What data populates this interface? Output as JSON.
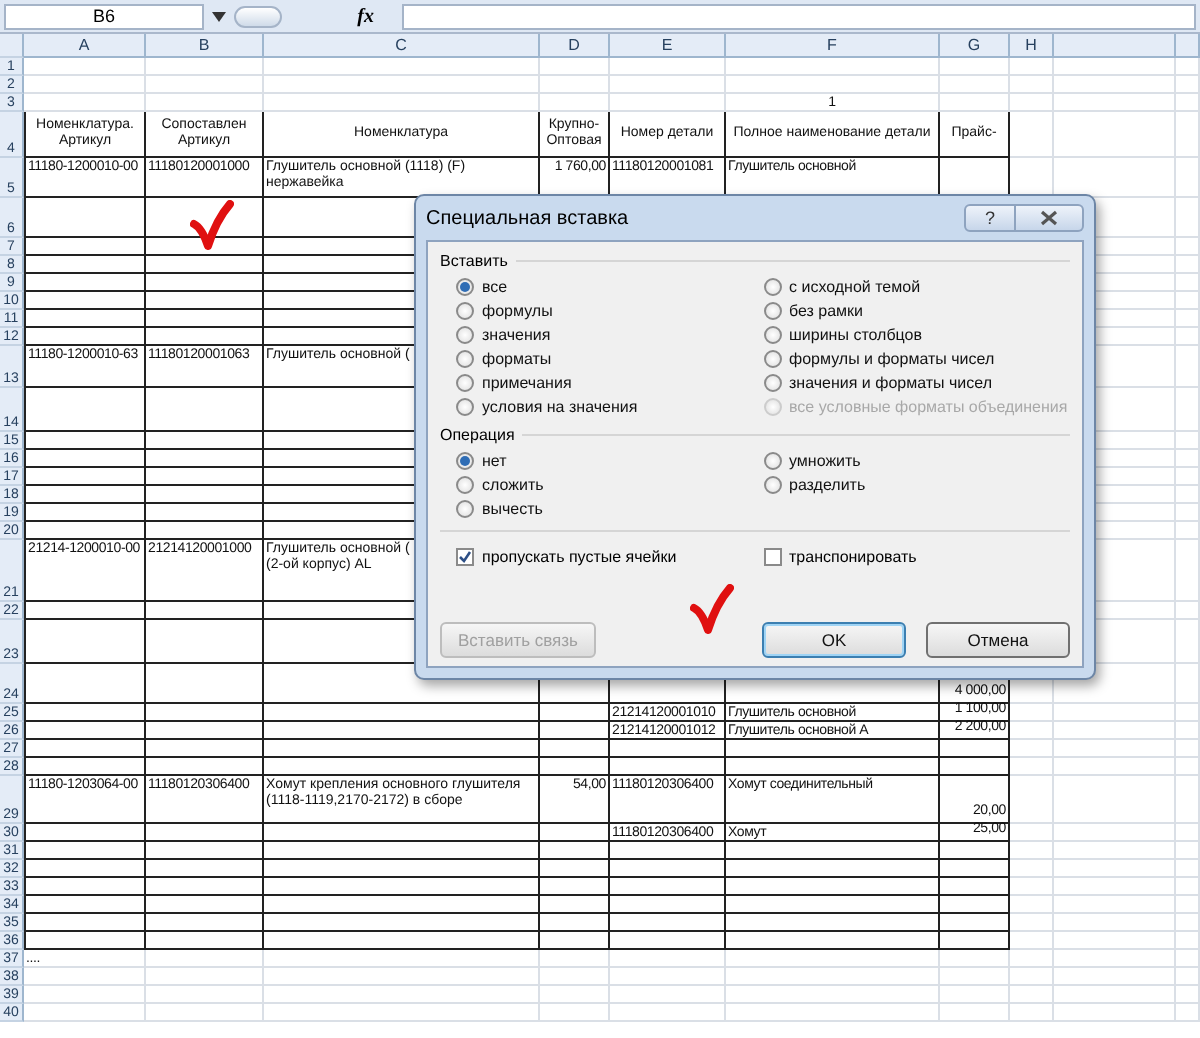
{
  "formula_bar": {
    "name_box": "B6",
    "function_label": "fx"
  },
  "sheet": {
    "columns": [
      "A",
      "B",
      "C",
      "D",
      "E",
      "F",
      "G",
      "H"
    ],
    "rows": [
      {
        "number": "1",
        "cells": {}
      },
      {
        "number": "2",
        "cells": {}
      },
      {
        "number": "3",
        "cells": {
          "f": "1"
        }
      },
      {
        "number": "4",
        "cells": {
          "a": "Номенклатура. Артикул",
          "b": "Сопоставлен Артикул",
          "c": "Номенклатура",
          "d": "Крупно-Оптовая",
          "e": "Номер детали",
          "f": "Полное наименование детали",
          "g": "Прайс-"
        }
      },
      {
        "number": "5",
        "cells": {
          "a": "11180-1200010-00",
          "b": "11180120001000",
          "c": "Глушитель основной (1118) (F) нержавейка",
          "d": "1 760,00",
          "e": "11180120001081",
          "f": "Глушитель основной"
        }
      },
      {
        "number": "6",
        "cells": {}
      },
      {
        "number": "7",
        "cells": {}
      },
      {
        "number": "8",
        "cells": {}
      },
      {
        "number": "9",
        "cells": {}
      },
      {
        "number": "10",
        "cells": {}
      },
      {
        "number": "11",
        "cells": {}
      },
      {
        "number": "12",
        "cells": {}
      },
      {
        "number": "13",
        "cells": {
          "a": "11180-1200010-63",
          "b": "11180120001063",
          "c": "Глушитель основной ("
        }
      },
      {
        "number": "14",
        "cells": {}
      },
      {
        "number": "15",
        "cells": {}
      },
      {
        "number": "16",
        "cells": {}
      },
      {
        "number": "17",
        "cells": {}
      },
      {
        "number": "18",
        "cells": {}
      },
      {
        "number": "19",
        "cells": {}
      },
      {
        "number": "20",
        "cells": {}
      },
      {
        "number": "21",
        "cells": {
          "a": "21214-1200010-00",
          "b": "21214120001000",
          "c": "Глушитель основной (\n(2-ой корпус) AL"
        }
      },
      {
        "number": "22",
        "cells": {}
      },
      {
        "number": "23",
        "cells": {}
      },
      {
        "number": "24",
        "cells": {
          "g": "4 000,00"
        }
      },
      {
        "number": "25",
        "cells": {
          "e": "21214120001010",
          "f": "Глушитель основной",
          "g": "1 100,00"
        }
      },
      {
        "number": "26",
        "cells": {
          "e": "21214120001012",
          "f": "Глушитель основной А",
          "g": "2 200,00"
        }
      },
      {
        "number": "27",
        "cells": {}
      },
      {
        "number": "28",
        "cells": {}
      },
      {
        "number": "29",
        "cells": {
          "a": "11180-1203064-00",
          "b": "11180120306400",
          "c": "Хомут крепления основного глушителя (1118-1119,2170-2172) в сборе",
          "d": "54,00",
          "e": "11180120306400",
          "f": "Хомут соединительный",
          "g": "20,00"
        }
      },
      {
        "number": "30",
        "cells": {
          "e": "11180120306400",
          "f": "Хомут",
          "g": "25,00"
        }
      },
      {
        "number": "31",
        "cells": {}
      },
      {
        "number": "32",
        "cells": {}
      },
      {
        "number": "33",
        "cells": {}
      },
      {
        "number": "34",
        "cells": {}
      },
      {
        "number": "35",
        "cells": {}
      },
      {
        "number": "36",
        "cells": {}
      },
      {
        "number": "37",
        "cells": {
          "a": "...."
        }
      },
      {
        "number": "38",
        "cells": {}
      },
      {
        "number": "39",
        "cells": {}
      },
      {
        "number": "40",
        "cells": {}
      }
    ]
  },
  "dialog": {
    "title": "Специальная вставка",
    "help": "?",
    "paste_group": {
      "label": "Вставить",
      "options": [
        {
          "label": "все",
          "selected": true,
          "disabled": false
        },
        {
          "label": "формулы",
          "selected": false,
          "disabled": false
        },
        {
          "label": "значения",
          "selected": false,
          "disabled": false
        },
        {
          "label": "форматы",
          "selected": false,
          "disabled": false
        },
        {
          "label": "примечания",
          "selected": false,
          "disabled": false
        },
        {
          "label": "условия на значения",
          "selected": false,
          "disabled": false
        },
        {
          "label": "с исходной темой",
          "selected": false,
          "disabled": false
        },
        {
          "label": "без рамки",
          "selected": false,
          "disabled": false
        },
        {
          "label": "ширины столбцов",
          "selected": false,
          "disabled": false
        },
        {
          "label": "формулы и форматы чисел",
          "selected": false,
          "disabled": false
        },
        {
          "label": "значения и форматы чисел",
          "selected": false,
          "disabled": false
        },
        {
          "label": "все условные форматы объединения",
          "selected": false,
          "disabled": true
        }
      ]
    },
    "operation_group": {
      "label": "Операция",
      "options": [
        {
          "label": "нет",
          "selected": true,
          "disabled": false
        },
        {
          "label": "сложить",
          "selected": false,
          "disabled": false
        },
        {
          "label": "вычесть",
          "selected": false,
          "disabled": false
        },
        {
          "label": "умножить",
          "selected": false,
          "disabled": false
        },
        {
          "label": "разделить",
          "selected": false,
          "disabled": false
        }
      ]
    },
    "skip_blanks": {
      "label": "пропускать пустые ячейки",
      "checked": true
    },
    "transpose": {
      "label": "транспонировать",
      "checked": false
    },
    "buttons": [
      {
        "label": "Вставить связь",
        "disabled": true,
        "default": false
      },
      {
        "label": "OK",
        "disabled": false,
        "default": true
      },
      {
        "label": "Отмена",
        "disabled": false,
        "default": false
      }
    ]
  }
}
